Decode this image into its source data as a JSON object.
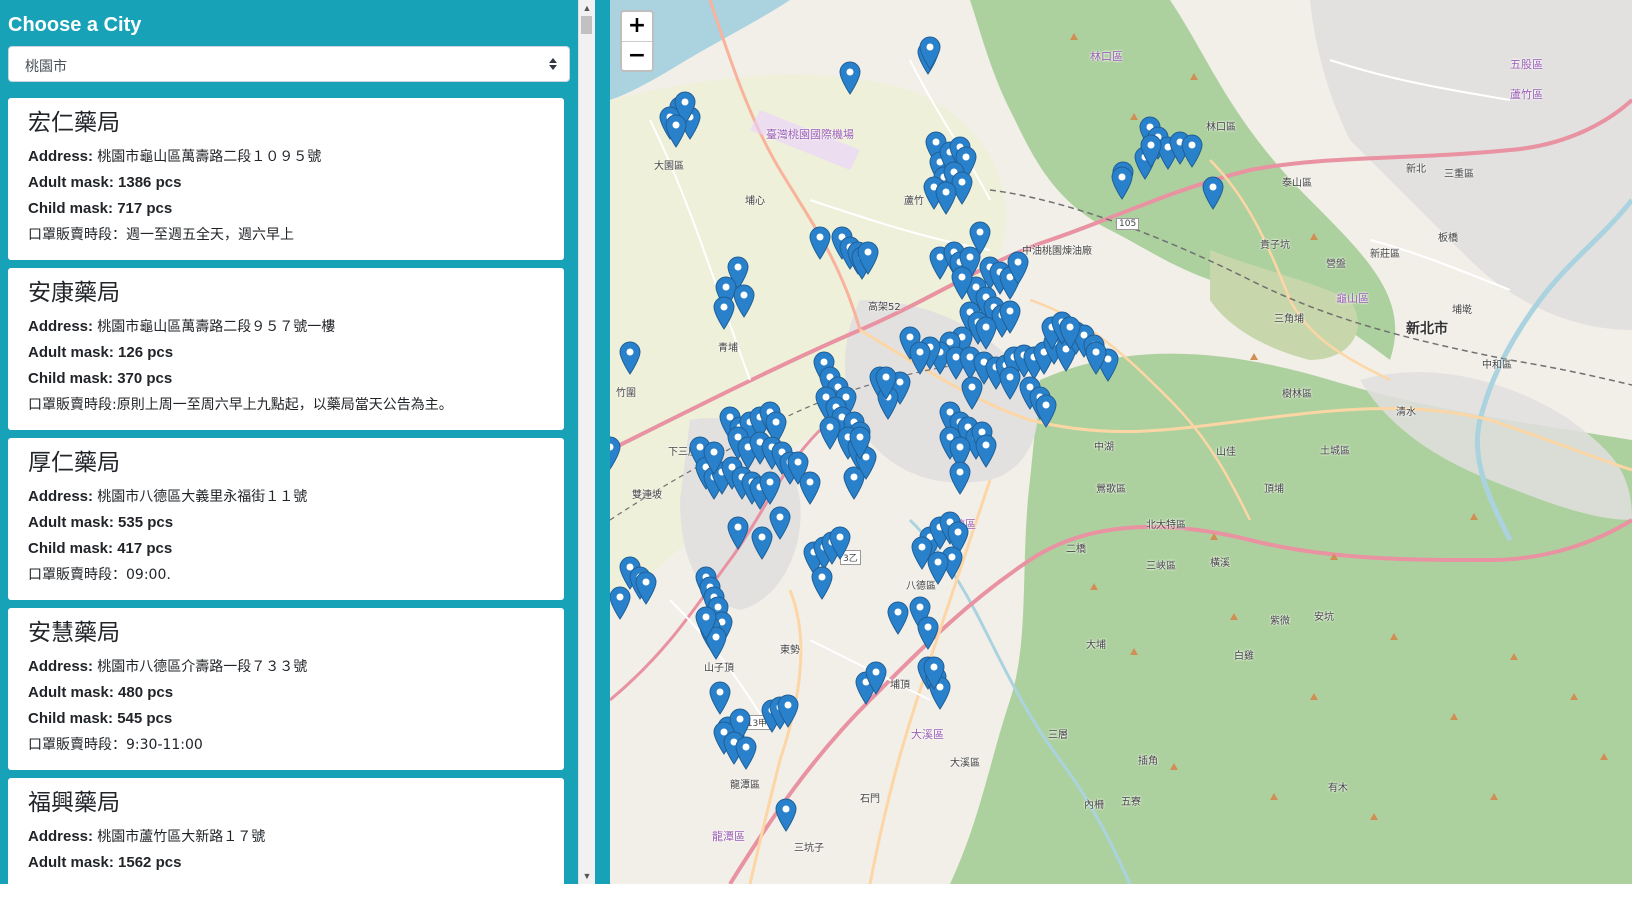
{
  "sidebar": {
    "title": "Choose a City",
    "city_select": {
      "selected": "桃園市"
    },
    "pharmacies": [
      {
        "name": "宏仁藥局",
        "address_label": "Address:",
        "address": "桃園市龜山區萬壽路二段１０９５號",
        "adult_label": "Adult mask:",
        "adult": "1386 pcs",
        "child_label": "Child mask:",
        "child": "717 pcs",
        "note": "口罩販賣時段：週一至週五全天，週六早上"
      },
      {
        "name": "安康藥局",
        "address_label": "Address:",
        "address": "桃園市龜山區萬壽路二段９５７號一樓",
        "adult_label": "Adult mask:",
        "adult": "126 pcs",
        "child_label": "Child mask:",
        "child": "370 pcs",
        "note": "口罩販賣時段:原則上周一至周六早上九點起，以藥局當天公告為主。"
      },
      {
        "name": "厚仁藥局",
        "address_label": "Address:",
        "address": "桃園市八德區大義里永福街１１號",
        "adult_label": "Adult mask:",
        "adult": "535 pcs",
        "child_label": "Child mask:",
        "child": "417 pcs",
        "note": "口罩販賣時段：09:00."
      },
      {
        "name": "安慧藥局",
        "address_label": "Address:",
        "address": "桃園市八德區介壽路一段７３３號",
        "adult_label": "Adult mask:",
        "adult": "480 pcs",
        "child_label": "Child mask:",
        "child": "545 pcs",
        "note": "口罩販賣時段：9:30-11:00"
      },
      {
        "name": "福興藥局",
        "address_label": "Address:",
        "address": "桃園市蘆竹區大新路１７號",
        "adult_label": "Adult mask:",
        "adult": "1562 pcs",
        "child_label": "Child mask:",
        "child": "",
        "note": ""
      }
    ]
  },
  "map": {
    "zoom_in": "+",
    "zoom_out": "−",
    "labels": [
      {
        "text": "林口區",
        "kind": "district"
      },
      {
        "text": "林口區",
        "kind": "plain"
      },
      {
        "text": "五股區",
        "kind": "district"
      },
      {
        "text": "蘆竹區",
        "kind": "district"
      },
      {
        "text": "龜山區",
        "kind": "district"
      },
      {
        "text": "八德區",
        "kind": "district"
      },
      {
        "text": "八德區",
        "kind": "plain"
      },
      {
        "text": "大溪區",
        "kind": "district"
      },
      {
        "text": "大溪區",
        "kind": "plain"
      },
      {
        "text": "龍潭區",
        "kind": "district"
      },
      {
        "text": "龍潭區",
        "kind": "plain"
      },
      {
        "text": "大園區",
        "kind": "plain"
      },
      {
        "text": "新北市",
        "kind": "city"
      },
      {
        "text": "臺灣桃園國際機場",
        "kind": "district"
      },
      {
        "text": "樹林區",
        "kind": "plain"
      },
      {
        "text": "土城區",
        "kind": "plain"
      },
      {
        "text": "三峽區",
        "kind": "plain"
      },
      {
        "text": "鶯歌區",
        "kind": "plain"
      },
      {
        "text": "新莊區",
        "kind": "plain"
      },
      {
        "text": "泰山區",
        "kind": "plain"
      },
      {
        "text": "三重區",
        "kind": "plain"
      },
      {
        "text": "板橋",
        "kind": "plain"
      },
      {
        "text": "中和區",
        "kind": "plain"
      },
      {
        "text": "頂埔",
        "kind": "plain"
      },
      {
        "text": "北大特區",
        "kind": "plain"
      },
      {
        "text": "二橋",
        "kind": "plain"
      },
      {
        "text": "石門",
        "kind": "plain"
      },
      {
        "text": "大埔",
        "kind": "plain"
      },
      {
        "text": "內柵",
        "kind": "plain"
      },
      {
        "text": "三層",
        "kind": "plain"
      },
      {
        "text": "埔頂",
        "kind": "plain"
      },
      {
        "text": "東勢",
        "kind": "plain"
      },
      {
        "text": "青埔",
        "kind": "plain"
      },
      {
        "text": "山子頂",
        "kind": "plain"
      },
      {
        "text": "三坑子",
        "kind": "plain"
      },
      {
        "text": "五寮",
        "kind": "plain"
      },
      {
        "text": "插角",
        "kind": "plain"
      },
      {
        "text": "有木",
        "kind": "plain"
      },
      {
        "text": "白雞",
        "kind": "plain"
      },
      {
        "text": "紫微",
        "kind": "plain"
      },
      {
        "text": "安坑",
        "kind": "plain"
      },
      {
        "text": "橫溪",
        "kind": "plain"
      },
      {
        "text": "埔墘",
        "kind": "plain"
      },
      {
        "text": "清水",
        "kind": "plain"
      },
      {
        "text": "山佳",
        "kind": "plain"
      },
      {
        "text": "營盤",
        "kind": "plain"
      },
      {
        "text": "貴子坑",
        "kind": "plain"
      },
      {
        "text": "三角埔",
        "kind": "plain"
      },
      {
        "text": "中湖",
        "kind": "plain"
      },
      {
        "text": "雙連坡",
        "kind": "plain"
      },
      {
        "text": "下三座屋",
        "kind": "plain"
      },
      {
        "text": "竹圍",
        "kind": "plain"
      },
      {
        "text": "埔心",
        "kind": "plain"
      },
      {
        "text": "中油桃園煉油廠",
        "kind": "plain"
      },
      {
        "text": "113甲",
        "kind": "road"
      },
      {
        "text": "105",
        "kind": "road"
      },
      {
        "text": "3乙",
        "kind": "road"
      },
      {
        "text": "高架52",
        "kind": "plain"
      },
      {
        "text": "蘆竹",
        "kind": "plain"
      },
      {
        "text": "新北",
        "kind": "plain"
      }
    ]
  },
  "colors": {
    "sidebar_bg": "#17a2b8",
    "marker": "#2a81cb",
    "water": "#aad3df",
    "forest": "#add19e",
    "motorway": "#e892a2",
    "trunk": "#f9b29c",
    "primary": "#fcd6a4"
  },
  "icons": {
    "marker": "map-marker-icon",
    "select_arrows": "sort-arrows-icon",
    "scroll_up": "triangle-up-icon",
    "scroll_down": "triangle-down-icon"
  }
}
